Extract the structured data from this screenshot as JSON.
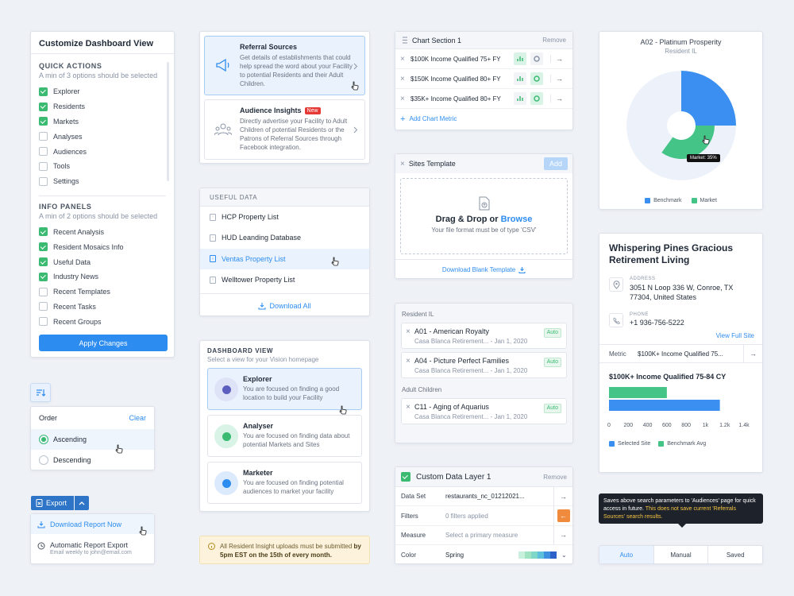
{
  "customize": {
    "title": "Customize Dashboard View",
    "qa_title": "QUICK ACTIONS",
    "qa_note": "A min of 3 options should be selected",
    "qa_items": [
      {
        "label": "Explorer",
        "on": true
      },
      {
        "label": "Residents",
        "on": true
      },
      {
        "label": "Markets",
        "on": true
      },
      {
        "label": "Analyses",
        "on": false
      },
      {
        "label": "Audiences",
        "on": false
      },
      {
        "label": "Tools",
        "on": false
      },
      {
        "label": "Settings",
        "on": false
      }
    ],
    "ip_title": "INFO PANELS",
    "ip_note": "A min of 2 options should be selected",
    "ip_items": [
      {
        "label": "Recent Analysis",
        "on": true
      },
      {
        "label": "Resident Mosaics Info",
        "on": true
      },
      {
        "label": "Useful Data",
        "on": true
      },
      {
        "label": "Industry News",
        "on": true
      },
      {
        "label": "Recent Templates",
        "on": false
      },
      {
        "label": "Recent Tasks",
        "on": false
      },
      {
        "label": "Recent Groups",
        "on": false
      }
    ],
    "apply": "Apply Changes"
  },
  "order": {
    "title": "Order",
    "clear": "Clear",
    "options": [
      "Ascending",
      "Descending"
    ]
  },
  "export": {
    "button": "Export",
    "download": "Download Report Now",
    "auto_title": "Automatic Report Export",
    "auto_sub": "Email weekly to john@email.com"
  },
  "referral": {
    "title": "Referral Sources",
    "desc": "Get details of establishments that could help spread the word about your Facility to potential Residents and their Adult Children."
  },
  "audience": {
    "title": "Audience Insights",
    "badge": "New",
    "desc": "Directly advertise your Facility to Adult Children of potential Residents or the Patrons of Referral Sources through Facebook integration."
  },
  "useful": {
    "title": "USEFUL DATA",
    "items": [
      "HCP Property List",
      "HUD Leanding Database",
      "Ventas Property List",
      "Welltower Property List"
    ],
    "download": "Download All"
  },
  "dashview": {
    "title": "DASHBOARD VIEW",
    "sub": "Select a view for your Vision homepage",
    "items": [
      {
        "title": "Explorer",
        "desc": "You are focused on finding a good location to build your Facility"
      },
      {
        "title": "Analyser",
        "desc": "You are focused on finding data about potential Markets and Sites"
      },
      {
        "title": "Marketer",
        "desc": "You are focused on finding potential audiences to market your facility"
      }
    ]
  },
  "notice": {
    "text": "All Resident Insight uploads must be submitted ",
    "bold": "by 5pm EST on the 15th of every month."
  },
  "chartsec": {
    "title": "Chart Section 1",
    "remove": "Remove",
    "rows": [
      "$100K Income Qualified 75+ FY",
      "$150K Income Qualified 80+ FY",
      "$35K+ Income Qualified 80+ FY"
    ],
    "add": "Add Chart Metric"
  },
  "sites": {
    "title": "Sites Template",
    "add": "Add",
    "drag": "Drag & Drop or ",
    "browse": "Browse",
    "format": "Your file format must be of type 'CSV'",
    "blank": "Download Blank Template"
  },
  "resident": {
    "group1": "Resident IL",
    "group2": "Adult Children",
    "items": [
      {
        "code": "A01 - American Royalty",
        "sub": "Casa Blanca Retirement... - Jan 1, 2020",
        "tag": "Auto"
      },
      {
        "code": "A04 - Picture Perfect Families",
        "sub": "Casa Blanca Retirement... - Jan 1, 2020",
        "tag": "Auto"
      },
      {
        "code": "C11 - Aging of Aquarius",
        "sub": "Casa Blanca Retirement... - Jan 1, 2020",
        "tag": "Auto"
      }
    ]
  },
  "layer": {
    "title": "Custom Data Layer 1",
    "remove": "Remove",
    "rows": [
      {
        "label": "Data Set",
        "value": "restaurants_nc_01212021..."
      },
      {
        "label": "Filters",
        "value": "0 filters applied"
      },
      {
        "label": "Measure",
        "value": "Select a primary measure"
      },
      {
        "label": "Color",
        "value": "Spring"
      }
    ],
    "swatches": [
      "#c9f0dc",
      "#9fe3c0",
      "#7fd7c8",
      "#5cc0dc",
      "#3f8fe0",
      "#2f62c8"
    ]
  },
  "donut": {
    "title": "A02 - Platinum Prosperity",
    "sub": "Resident IL",
    "tooltip": "Market: 35%",
    "legend": [
      "Benchmark",
      "Market"
    ]
  },
  "chart_data": {
    "type": "pie",
    "title": "A02 - Platinum Prosperity",
    "series": [
      {
        "name": "Benchmark",
        "value": 25
      },
      {
        "name": "Market",
        "value": 35
      }
    ]
  },
  "property": {
    "name": "Whispering Pines Gracious Retirement Living",
    "addr_label": "ADDRESS",
    "addr": "3051 N Loop 336 W, Conroe, TX 77304, United States",
    "phone_label": "PHONE",
    "phone": "+1 936-756-5222",
    "view": "View Full Site",
    "metric_label": "Metric",
    "metric_val": "$100K+ Income Qualified 75...",
    "chart_title": "$100K+ Income Qualified 75-84 CY",
    "ticks": [
      "0",
      "200",
      "400",
      "600",
      "800",
      "1k",
      "1.2k",
      "1.4k"
    ],
    "legend": [
      "Selected Site",
      "Benchmark Avg"
    ],
    "bars": {
      "selected": 1150,
      "benchmark": 600
    },
    "xmax": 1400
  },
  "tooltip2": {
    "text": "Saves above search parameters to 'Audiences' page for quick access in future. ",
    "warn": "This does not save current 'Referrals Sources' search results."
  },
  "tabs": [
    "Auto",
    "Manual",
    "Saved"
  ],
  "colors": {
    "blue": "#2d8cf0",
    "green": "#3bba72",
    "orange": "#f08a3c"
  }
}
